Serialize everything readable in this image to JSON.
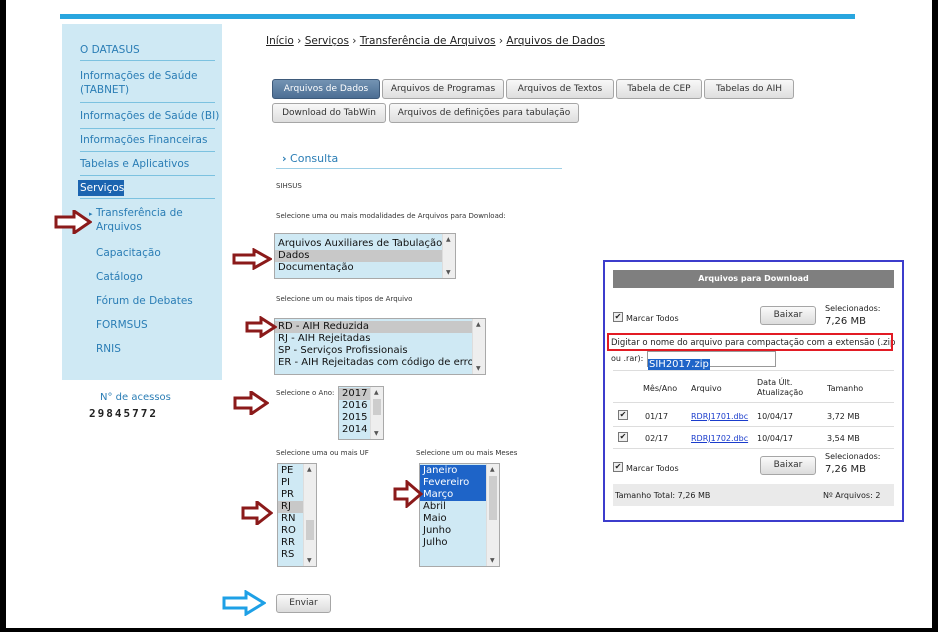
{
  "breadcrumb": [
    "Início",
    "Serviços",
    "Transferência de Arquivos",
    "Arquivos de Dados"
  ],
  "breadcrumb_sep": "›",
  "sidebar": {
    "items": [
      "O DATASUS",
      "Informações de Saúde",
      "(TABNET)",
      "Informações de Saúde (BI)",
      "Informações Financeiras",
      "Tabelas e Aplicativos"
    ],
    "active": "Serviços",
    "sub": [
      "Transferência de",
      "Arquivos",
      "Capacitação",
      "Catálogo",
      "Fórum de Debates",
      "FORMSUS",
      "RNIS"
    ],
    "access_label": "N° de acessos",
    "access_count": "29845772"
  },
  "tabs": [
    "Arquivos de Dados",
    "Arquivos de Programas",
    "Arquivos de Textos",
    "Tabela de CEP",
    "Tabelas do AIH",
    "Download do TabWin",
    "Arquivos de definições para tabulação"
  ],
  "consulta": "Consulta",
  "source": "SIHSUS",
  "labels": {
    "modalidades": "Selecione uma ou mais modalidades de Arquivos para Download:",
    "tipos": "Selecione um ou mais tipos de Arquivo",
    "ano": "Selecione o Ano:",
    "uf": "Selecione uma ou mais UF",
    "meses": "Selecione um ou mais Meses"
  },
  "modalidades": [
    "Arquivos Auxiliares de Tabulação",
    "Dados",
    "Documentação"
  ],
  "tipos": [
    "RD - AIH Reduzida",
    "RJ - AIH Rejeitadas",
    "SP - Serviços Profissionais",
    "ER - AIH Rejeitadas com código de erro"
  ],
  "anos": [
    "2017",
    "2016",
    "2015",
    "2014"
  ],
  "ufs": [
    "PE",
    "PI",
    "PR",
    "RJ",
    "RN",
    "RO",
    "RR",
    "RS"
  ],
  "meses": [
    "Janeiro",
    "Fevereiro",
    "Março",
    "Abril",
    "Maio",
    "Junho",
    "Julho"
  ],
  "submit": "Enviar",
  "download": {
    "title": "Arquivos para Download",
    "marcar_todos": "Marcar Todos",
    "baixar": "Baixar",
    "selecionados_label": "Selecionados:",
    "selecionados_value": "7,26 MB",
    "instrucao": "Digitar o nome do arquivo para compactação com a extensão (.zip",
    "instrucao2": "ou .rar):",
    "filename": "SIH2017.zip",
    "columns": [
      "Mês/Ano",
      "Arquivo",
      "Data Últ.",
      "Atualização",
      "Tamanho"
    ],
    "rows": [
      {
        "mes": "01/17",
        "arquivo": "RDRJ1701.dbc",
        "data": "10/04/17",
        "tamanho": "3,72 MB"
      },
      {
        "mes": "02/17",
        "arquivo": "RDRJ1702.dbc",
        "data": "10/04/17",
        "tamanho": "3,54 MB"
      }
    ],
    "total": "Tamanho Total: 7,26 MB",
    "n_arquivos": "Nº Arquivos: 2"
  },
  "colors": {
    "arrow_red": "#8b1a1a",
    "arrow_blue": "#1ea0e6",
    "accent": "#2a7db5"
  }
}
